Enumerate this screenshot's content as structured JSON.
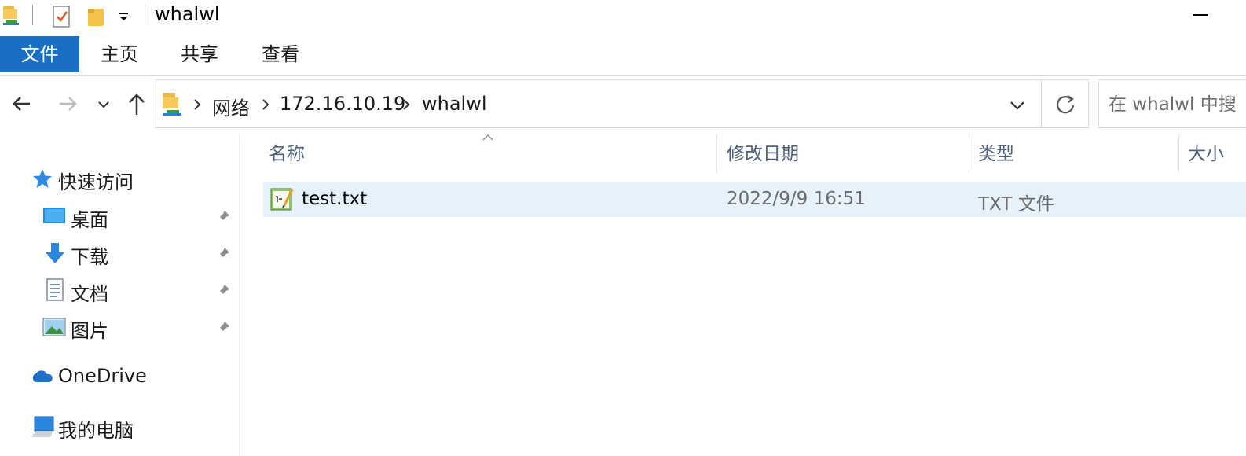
{
  "window": {
    "title": "whalwl"
  },
  "ribbon": {
    "tabs": [
      {
        "label": "文件",
        "active": true
      },
      {
        "label": "主页"
      },
      {
        "label": "共享"
      },
      {
        "label": "查看"
      }
    ]
  },
  "address": {
    "crumbs": [
      "网络",
      "172.16.10.19",
      "whalwl"
    ]
  },
  "search": {
    "placeholder": "在 whalwl 中搜"
  },
  "sidebar": {
    "quick_access": "快速访问",
    "items": [
      {
        "label": "桌面",
        "icon": "desktop-icon",
        "pinned": true
      },
      {
        "label": "下载",
        "icon": "download-icon",
        "pinned": true
      },
      {
        "label": "文档",
        "icon": "documents-icon",
        "pinned": true
      },
      {
        "label": "图片",
        "icon": "pictures-icon",
        "pinned": true
      }
    ],
    "onedrive": "OneDrive",
    "this_pc": "我的电脑"
  },
  "columns": {
    "name": "名称",
    "modified": "修改日期",
    "type": "类型",
    "size": "大小"
  },
  "files": [
    {
      "name": "test.txt",
      "modified": "2022/9/9 16:51",
      "type": "TXT 文件",
      "size": "",
      "selected": true
    }
  ],
  "colors": {
    "accent": "#1a6fc4",
    "selection": "#e5f1fb",
    "header_text": "#4c607a"
  }
}
